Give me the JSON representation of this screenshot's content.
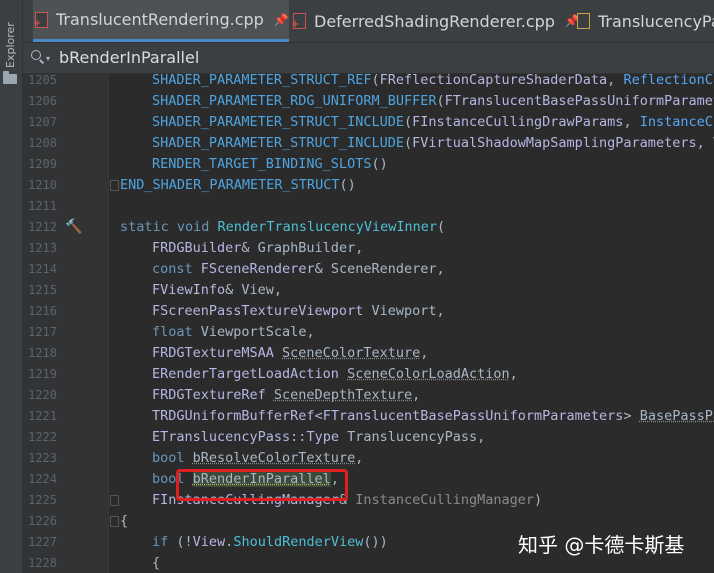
{
  "sidebar": {
    "label": "Explorer"
  },
  "tabs": [
    {
      "name": "TranslucentRendering.cpp",
      "active": true
    },
    {
      "name": "DeferredShadingRenderer.cpp",
      "active": false
    },
    {
      "name": "TranslucencyPas",
      "active": false
    }
  ],
  "search": {
    "value": "bRenderInParallel"
  },
  "lines": [
    {
      "num": "1205",
      "parts": [
        [
          "    ",
          ""
        ],
        [
          "SHADER_PARAMETER_STRUCT_REF",
          "macro"
        ],
        [
          "(",
          ""
        ],
        [
          "FReflectionCaptureShaderData",
          "cls"
        ],
        [
          ", ",
          ""
        ],
        [
          "ReflectionCap",
          "tp"
        ]
      ]
    },
    {
      "num": "1206",
      "parts": [
        [
          "    ",
          ""
        ],
        [
          "SHADER_PARAMETER_RDG_UNIFORM_BUFFER",
          "macro"
        ],
        [
          "(",
          ""
        ],
        [
          "FTranslucentBasePassUniformParamete",
          "cls"
        ]
      ]
    },
    {
      "num": "1207",
      "parts": [
        [
          "    ",
          ""
        ],
        [
          "SHADER_PARAMETER_STRUCT_INCLUDE",
          "macro"
        ],
        [
          "(",
          ""
        ],
        [
          "FInstanceCullingDrawParams",
          "cls"
        ],
        [
          ", ",
          ""
        ],
        [
          "InstanceCu",
          "tp"
        ]
      ]
    },
    {
      "num": "1208",
      "parts": [
        [
          "    ",
          ""
        ],
        [
          "SHADER_PARAMETER_STRUCT_INCLUDE",
          "macro"
        ],
        [
          "(",
          ""
        ],
        [
          "FVirtualShadowMapSamplingParameters",
          "cls"
        ],
        [
          ", Vi",
          ""
        ]
      ]
    },
    {
      "num": "1209",
      "parts": [
        [
          "    ",
          ""
        ],
        [
          "RENDER_TARGET_BINDING_SLOTS",
          "macro"
        ],
        [
          "()",
          ""
        ]
      ]
    },
    {
      "num": "1210",
      "parts": [
        [
          "END_SHADER_PARAMETER_STRUCT",
          "macro"
        ],
        [
          "()",
          ""
        ]
      ]
    },
    {
      "num": "1211",
      "parts": []
    },
    {
      "num": "1212",
      "parts": [
        [
          "static void ",
          "kb"
        ],
        [
          "RenderTranslucencyViewInner",
          "fn"
        ],
        [
          "(",
          ""
        ]
      ]
    },
    {
      "num": "1213",
      "parts": [
        [
          "    ",
          ""
        ],
        [
          "FRDGBuilder",
          "cls"
        ],
        [
          "& GraphBuilder,",
          ""
        ]
      ]
    },
    {
      "num": "1214",
      "parts": [
        [
          "    ",
          ""
        ],
        [
          "const ",
          "kb"
        ],
        [
          "FSceneRenderer",
          "cls"
        ],
        [
          "& SceneRenderer,",
          ""
        ]
      ]
    },
    {
      "num": "1215",
      "parts": [
        [
          "    ",
          ""
        ],
        [
          "FViewInfo",
          "cls"
        ],
        [
          "& View,",
          ""
        ]
      ]
    },
    {
      "num": "1216",
      "parts": [
        [
          "    ",
          ""
        ],
        [
          "FScreenPassTextureViewport",
          "cls"
        ],
        [
          " Viewport,",
          ""
        ]
      ]
    },
    {
      "num": "1217",
      "parts": [
        [
          "    ",
          ""
        ],
        [
          "float ",
          "kb"
        ],
        [
          "ViewportScale,",
          ""
        ]
      ]
    },
    {
      "num": "1218",
      "parts": [
        [
          "    ",
          ""
        ],
        [
          "FRDGTextureMSAA ",
          "cls"
        ],
        [
          "SceneColorTexture",
          "dotted"
        ],
        [
          ",",
          ""
        ]
      ]
    },
    {
      "num": "1219",
      "parts": [
        [
          "    ",
          ""
        ],
        [
          "ERenderTargetLoadAction ",
          "cls"
        ],
        [
          "SceneColorLoadAction",
          "dotted"
        ],
        [
          ",",
          ""
        ]
      ]
    },
    {
      "num": "1220",
      "parts": [
        [
          "    ",
          ""
        ],
        [
          "FRDGTextureRef ",
          "cls"
        ],
        [
          "SceneDepthTexture",
          "dotted"
        ],
        [
          ",",
          ""
        ]
      ]
    },
    {
      "num": "1221",
      "parts": [
        [
          "    ",
          ""
        ],
        [
          "TRDGUniformBufferRef",
          "cls"
        ],
        [
          "<",
          ""
        ],
        [
          "FTranslucentBasePassUniformParameters",
          "cls"
        ],
        [
          "> ",
          ""
        ],
        [
          "BasePassPar",
          "dotted"
        ]
      ]
    },
    {
      "num": "1222",
      "parts": [
        [
          "    ",
          ""
        ],
        [
          "ETranslucencyPass",
          "cls"
        ],
        [
          "::",
          ""
        ],
        [
          "Type",
          "cls"
        ],
        [
          " TranslucencyPass,",
          ""
        ]
      ]
    },
    {
      "num": "1223",
      "parts": [
        [
          "    ",
          ""
        ],
        [
          "bool ",
          "kb"
        ],
        [
          "bResolveColorTexture",
          "dotted"
        ],
        [
          ",",
          ""
        ]
      ]
    },
    {
      "num": "1224",
      "parts": [
        [
          "    ",
          ""
        ],
        [
          "bool ",
          "kb"
        ],
        [
          "bRenderInParallel",
          "hl"
        ],
        [
          ",",
          ""
        ]
      ]
    },
    {
      "num": "1225",
      "parts": [
        [
          "    ",
          ""
        ],
        [
          "FInstanceCullingManager",
          "cls"
        ],
        [
          "& ",
          ""
        ],
        [
          "InstanceCullingManager",
          "dim"
        ],
        [
          ")",
          ""
        ]
      ]
    },
    {
      "num": "1226",
      "parts": [
        [
          "{",
          ""
        ]
      ]
    },
    {
      "num": "1227",
      "parts": [
        [
          "    ",
          ""
        ],
        [
          "if ",
          "kb"
        ],
        [
          "(!",
          ""
        ],
        [
          "View",
          "cls"
        ],
        [
          ".",
          ""
        ],
        [
          "ShouldRenderView",
          "fn"
        ],
        [
          "())",
          ""
        ]
      ]
    },
    {
      "num": "1228",
      "parts": [
        [
          "    {",
          ""
        ]
      ]
    }
  ],
  "watermark": "知乎 @卡德卡斯基"
}
